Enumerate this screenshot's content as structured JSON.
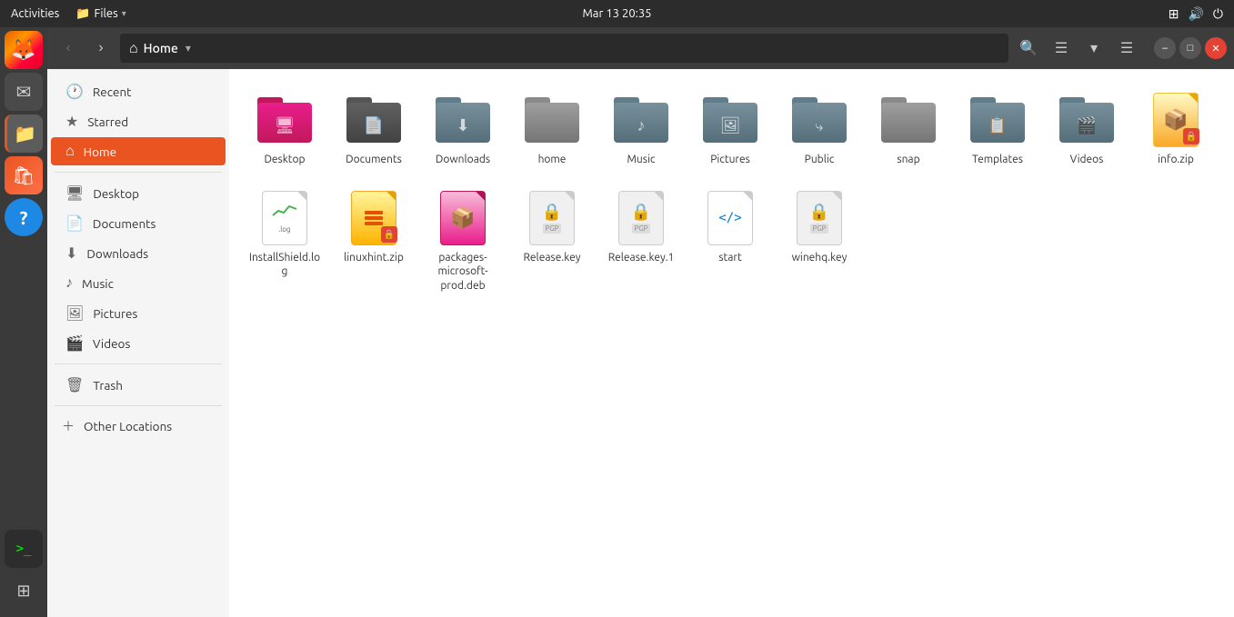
{
  "system_bar": {
    "activities": "Activities",
    "files_menu": "Files",
    "datetime": "Mar 13  20:35"
  },
  "title_bar": {
    "location": "Home",
    "back_label": "‹",
    "forward_label": "›",
    "home_symbol": "⌂",
    "dropdown_symbol": "▾",
    "search_tooltip": "Search",
    "view_list_tooltip": "List View",
    "view_options_tooltip": "View Options",
    "menu_tooltip": "Menu",
    "minimize_label": "–",
    "maximize_label": "□",
    "close_label": "✕"
  },
  "sidebar": {
    "items": [
      {
        "id": "recent",
        "label": "Recent",
        "icon": "🕐"
      },
      {
        "id": "starred",
        "label": "Starred",
        "icon": "★"
      },
      {
        "id": "home",
        "label": "Home",
        "icon": "⌂",
        "active": true
      },
      {
        "id": "desktop",
        "label": "Desktop",
        "icon": "🖥"
      },
      {
        "id": "documents",
        "label": "Documents",
        "icon": "📄"
      },
      {
        "id": "downloads",
        "label": "Downloads",
        "icon": "⬇"
      },
      {
        "id": "music",
        "label": "Music",
        "icon": "♪"
      },
      {
        "id": "pictures",
        "label": "Pictures",
        "icon": "🖼"
      },
      {
        "id": "videos",
        "label": "Videos",
        "icon": "🎬"
      },
      {
        "id": "trash",
        "label": "Trash",
        "icon": "🗑"
      }
    ],
    "other_locations": "Other Locations"
  },
  "files": [
    {
      "id": "desktop",
      "name": "Desktop",
      "type": "folder",
      "color": "pink"
    },
    {
      "id": "documents",
      "name": "Documents",
      "type": "folder",
      "color": "dark"
    },
    {
      "id": "downloads",
      "name": "Downloads",
      "type": "folder",
      "color": "download"
    },
    {
      "id": "home",
      "name": "home",
      "type": "folder",
      "color": "gray"
    },
    {
      "id": "music",
      "name": "Music",
      "type": "folder",
      "color": "gray"
    },
    {
      "id": "pictures",
      "name": "Pictures",
      "type": "folder",
      "color": "gray"
    },
    {
      "id": "public",
      "name": "Public",
      "type": "folder",
      "color": "share"
    },
    {
      "id": "snap",
      "name": "snap",
      "type": "folder",
      "color": "gray"
    },
    {
      "id": "templates",
      "name": "Templates",
      "type": "folder",
      "color": "gray"
    },
    {
      "id": "videos",
      "name": "Videos",
      "type": "folder",
      "color": "gray"
    },
    {
      "id": "info-zip",
      "name": "info.zip",
      "type": "zip-special"
    },
    {
      "id": "installshield",
      "name": "InstallShield.log",
      "type": "log"
    },
    {
      "id": "linuxhint-zip",
      "name": "linuxhint.zip",
      "type": "zip-yellow"
    },
    {
      "id": "packages-deb",
      "name": "packages-microsoft-prod.deb",
      "type": "deb"
    },
    {
      "id": "release-key",
      "name": "Release.key",
      "type": "pgp"
    },
    {
      "id": "release-key-1",
      "name": "Release.key.1",
      "type": "pgp"
    },
    {
      "id": "start",
      "name": "start",
      "type": "html"
    },
    {
      "id": "winehq-key",
      "name": "winehq.key",
      "type": "pgp"
    }
  ],
  "taskbar_icons": [
    {
      "id": "firefox",
      "label": "Firefox"
    },
    {
      "id": "mail",
      "label": "Mail"
    },
    {
      "id": "files",
      "label": "Files"
    },
    {
      "id": "ubuntu-software",
      "label": "Ubuntu Software"
    },
    {
      "id": "help",
      "label": "Help"
    },
    {
      "id": "terminal",
      "label": "Terminal"
    }
  ]
}
